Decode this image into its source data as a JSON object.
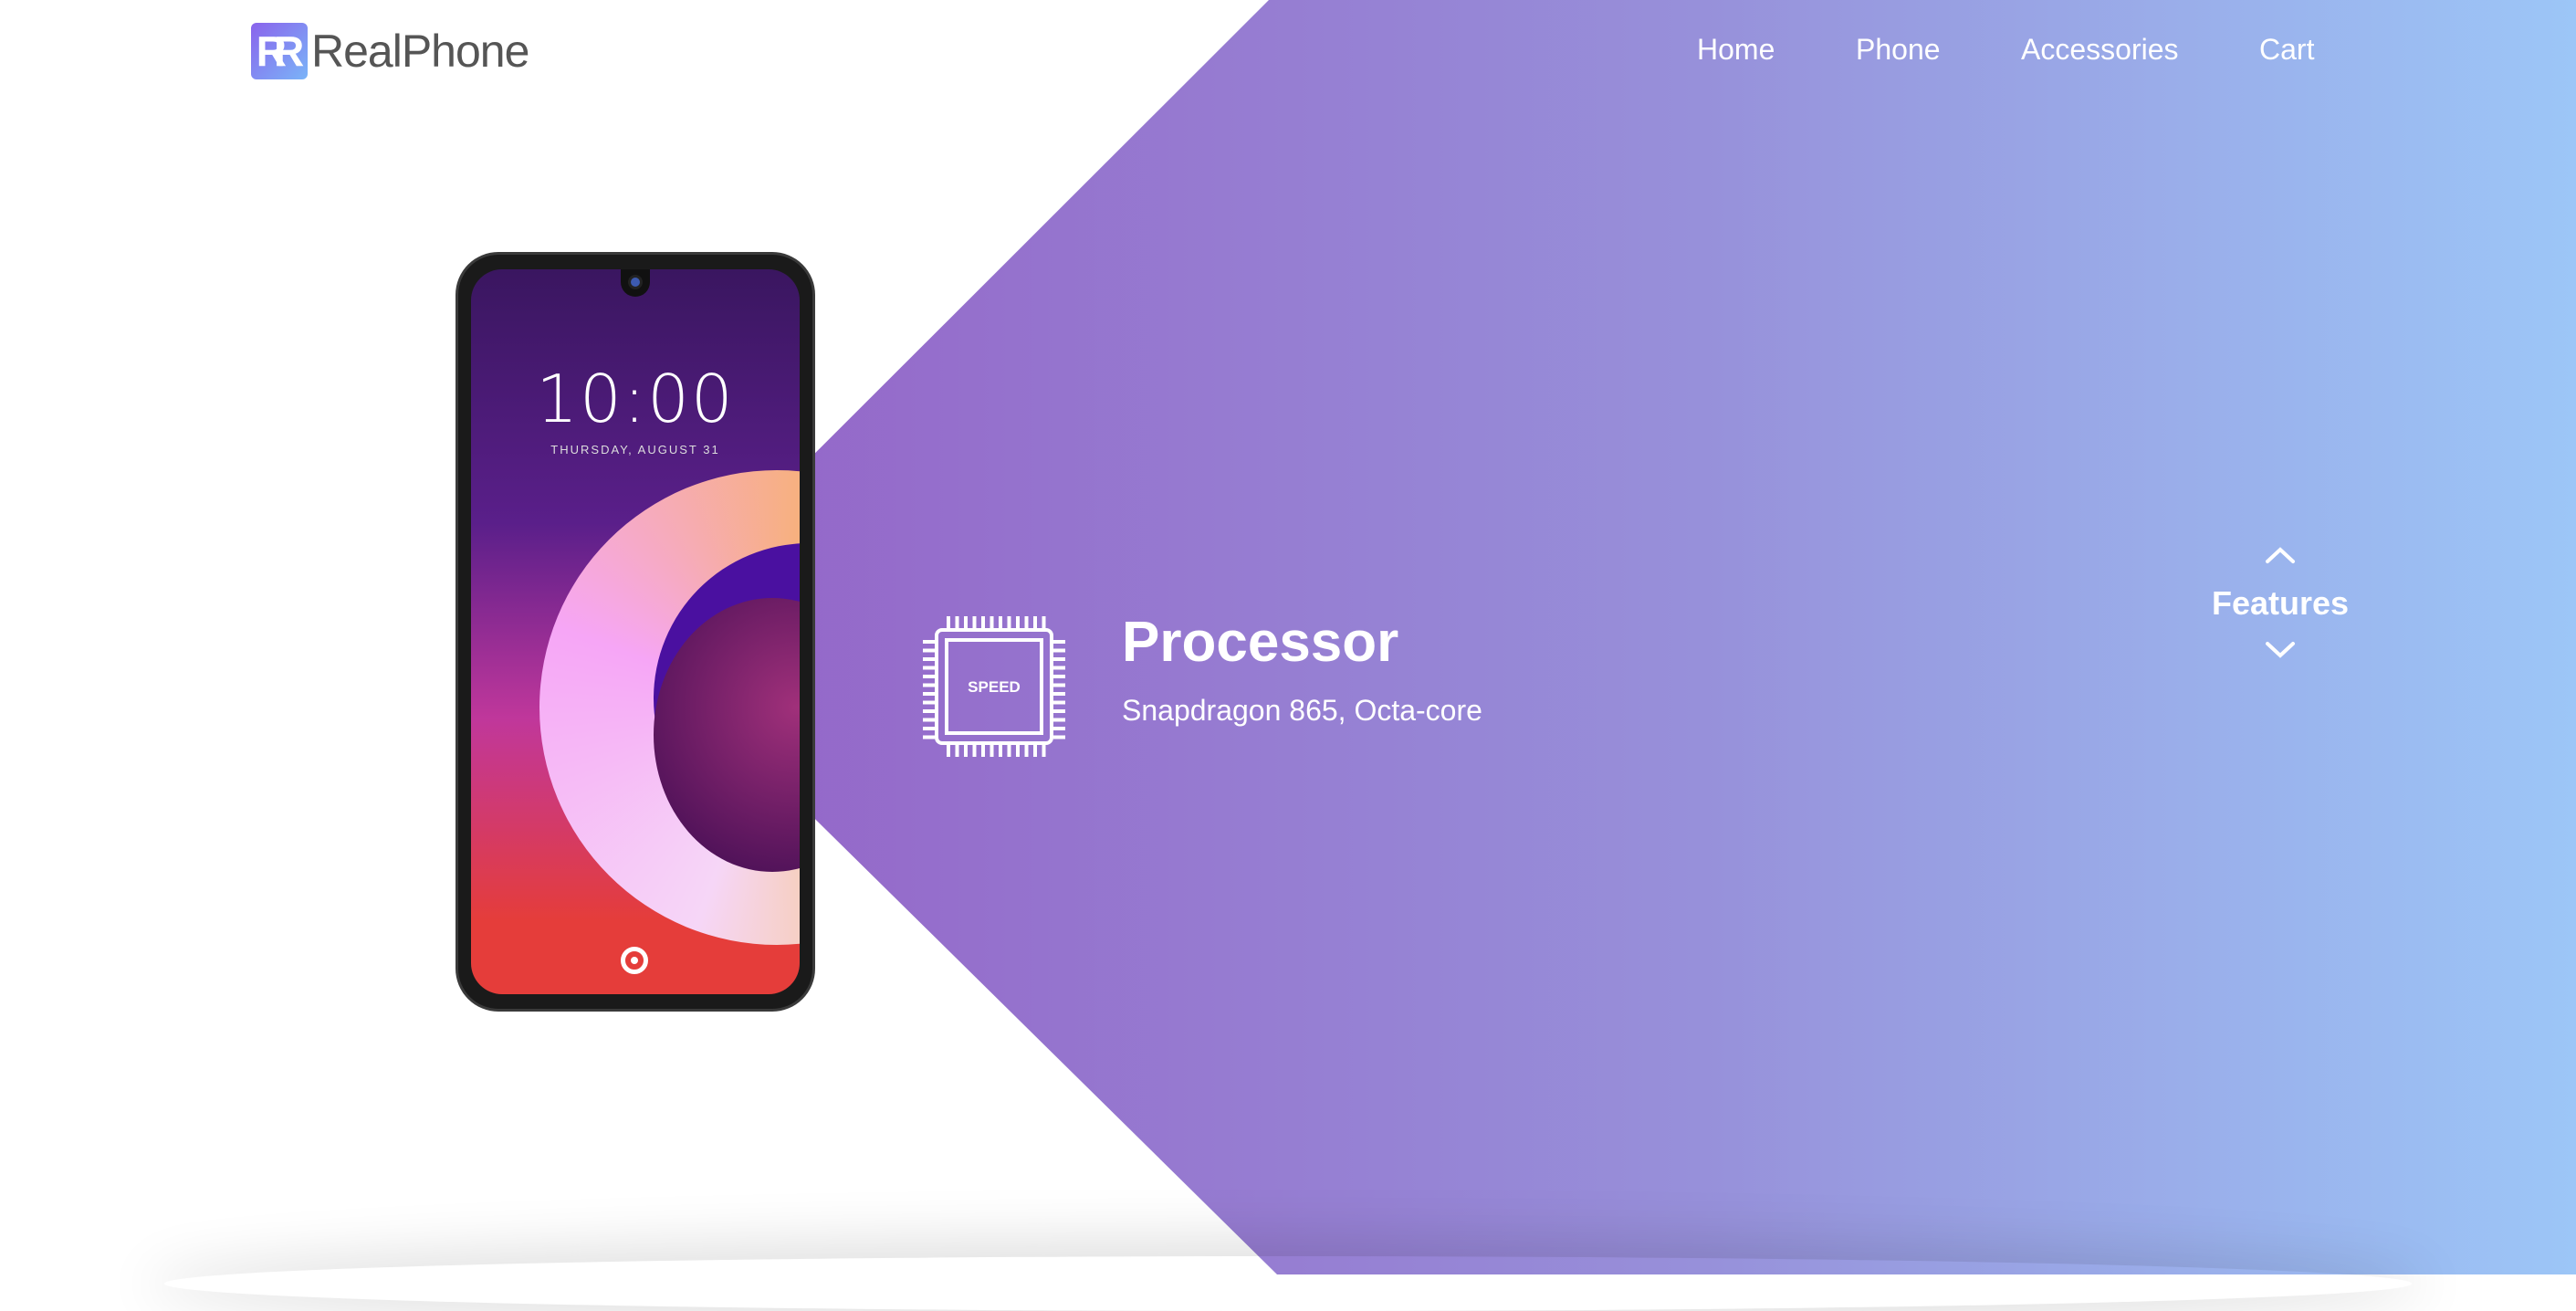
{
  "brand": {
    "name": "RealPhone",
    "icon_letters": "RR"
  },
  "nav": [
    {
      "label": "Home"
    },
    {
      "label": "Phone"
    },
    {
      "label": "Accessories"
    },
    {
      "label": "Cart"
    }
  ],
  "phone_screen": {
    "time": "10:00",
    "date": "THURSDAY, AUGUST 31"
  },
  "feature": {
    "icon": "processor-chip-icon",
    "icon_text": "SPEED",
    "title": "Processor",
    "description": "Snapdragon 865, Octa-core"
  },
  "carousel": {
    "label": "Features"
  },
  "colors": {
    "gradient_start": "#9461c6",
    "gradient_end": "#9cc6f7",
    "logo_text": "#555555"
  }
}
